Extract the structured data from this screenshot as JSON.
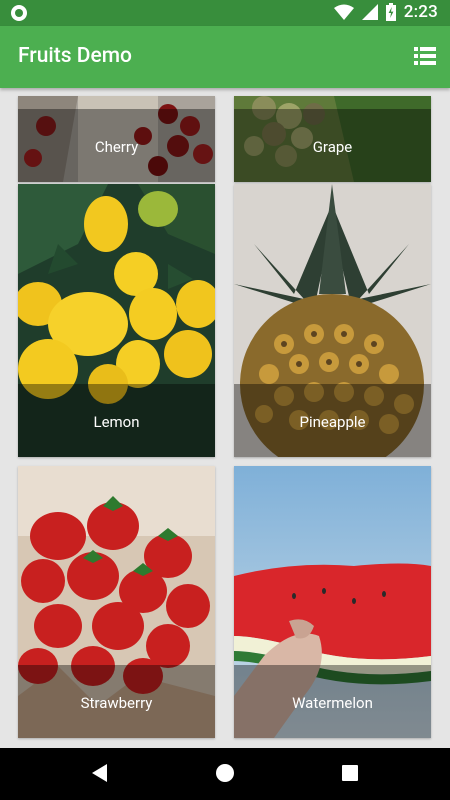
{
  "status": {
    "time": "2:23"
  },
  "appbar": {
    "title": "Fruits Demo",
    "icon": "list-icon"
  },
  "fruits": [
    {
      "name": "Cherry"
    },
    {
      "name": "Grape"
    },
    {
      "name": "Lemon"
    },
    {
      "name": "Pineapple"
    },
    {
      "name": "Strawberry"
    },
    {
      "name": "Watermelon"
    }
  ],
  "colors": {
    "status_bar": "#388e3c",
    "app_bar": "#4caf50",
    "nav_bar": "#000000"
  }
}
